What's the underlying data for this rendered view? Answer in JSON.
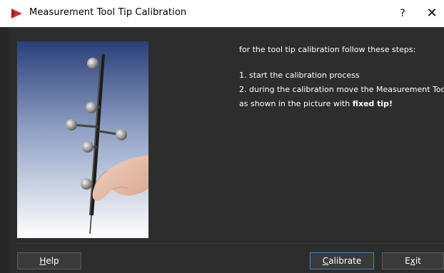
{
  "window": {
    "title": "Measurement Tool Tip Calibration",
    "help_glyph": "?",
    "close_glyph": "✕"
  },
  "instructions": {
    "intro": "for the tool tip calibration follow these steps:",
    "step1": "1. start the calibration process",
    "step2_line1": "2. during the calibration move the Measurement Tool",
    "step2_line2_prefix": "as shown in the picture with ",
    "step2_bold": "fixed tip!"
  },
  "buttons": {
    "help_u": "H",
    "help_rest": "elp",
    "calibrate_u": "C",
    "calibrate_rest": "alibrate",
    "exit_pre": "E",
    "exit_u": "x",
    "exit_rest": "it"
  },
  "colors": {
    "dialog_bg": "#2d2d2d",
    "titlebar_bg": "#ffffff",
    "accent_red": "#d42b2b",
    "focus_border": "#4a7fc0"
  },
  "icons": {
    "app": "red-play-triangle-icon",
    "help": "question-mark-icon",
    "close": "close-icon"
  }
}
